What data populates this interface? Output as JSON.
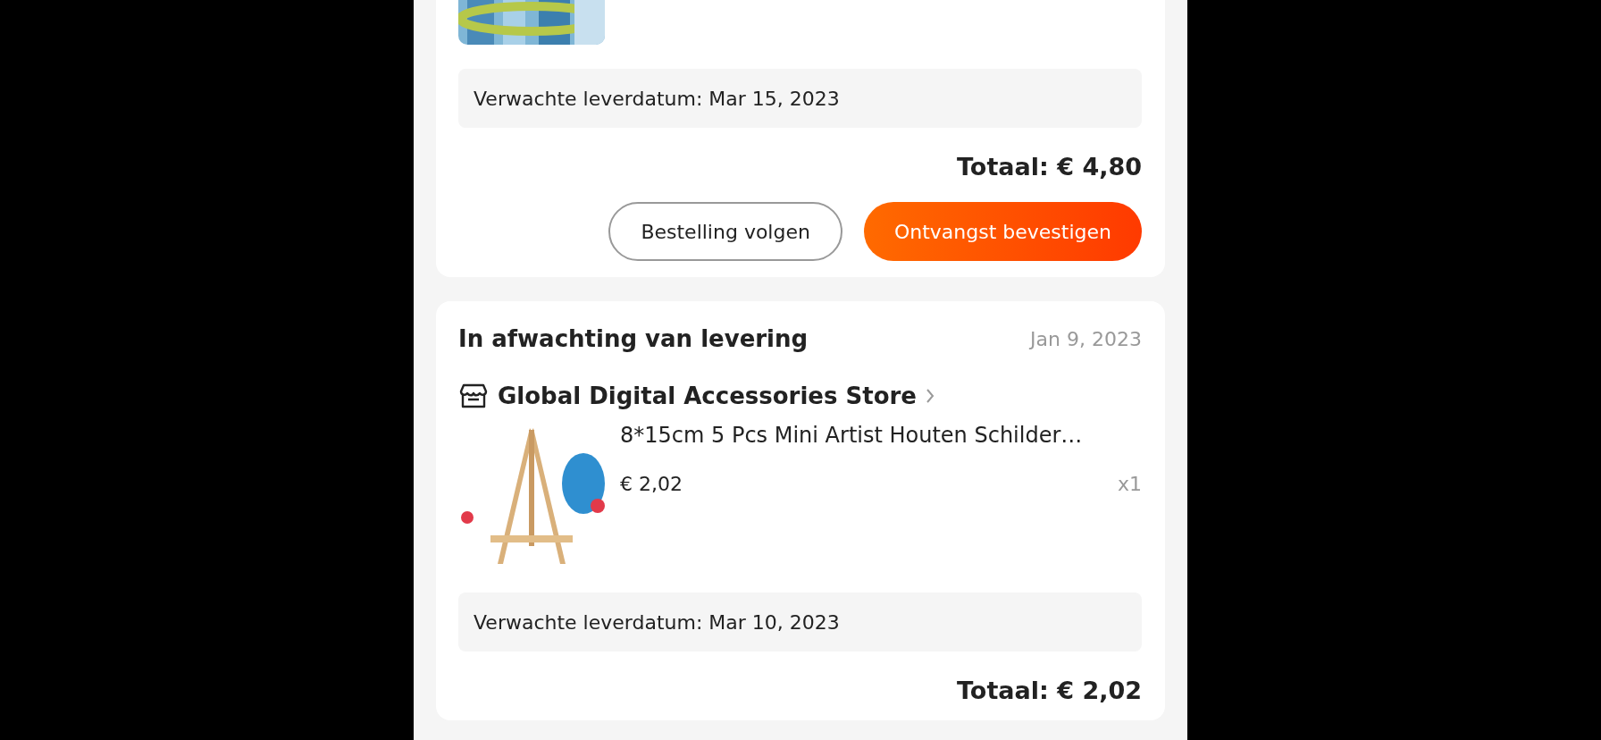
{
  "orders": [
    {
      "delivery": "Verwachte leverdatum: Mar 15, 2023",
      "total": "Totaal: € 4,80",
      "buttons": [
        {
          "label": "Bestelling volgen",
          "kind": "outline"
        },
        {
          "label": "Ontvangst bevestigen",
          "kind": "primary"
        }
      ]
    },
    {
      "status": "In afwachting van levering",
      "date": "Jan 9, 2023",
      "store": "Global Digital Accessories Store",
      "products": [
        {
          "kind": "picture",
          "title": "8*15cm 5 Pcs Mini Artist Houten Schilder…",
          "price": "€ 2,02",
          "qty": "x1"
        }
      ],
      "delivery": "Verwachte leverdatum: Mar 10, 2023",
      "total": "Totaal: € 2,02"
    }
  ]
}
